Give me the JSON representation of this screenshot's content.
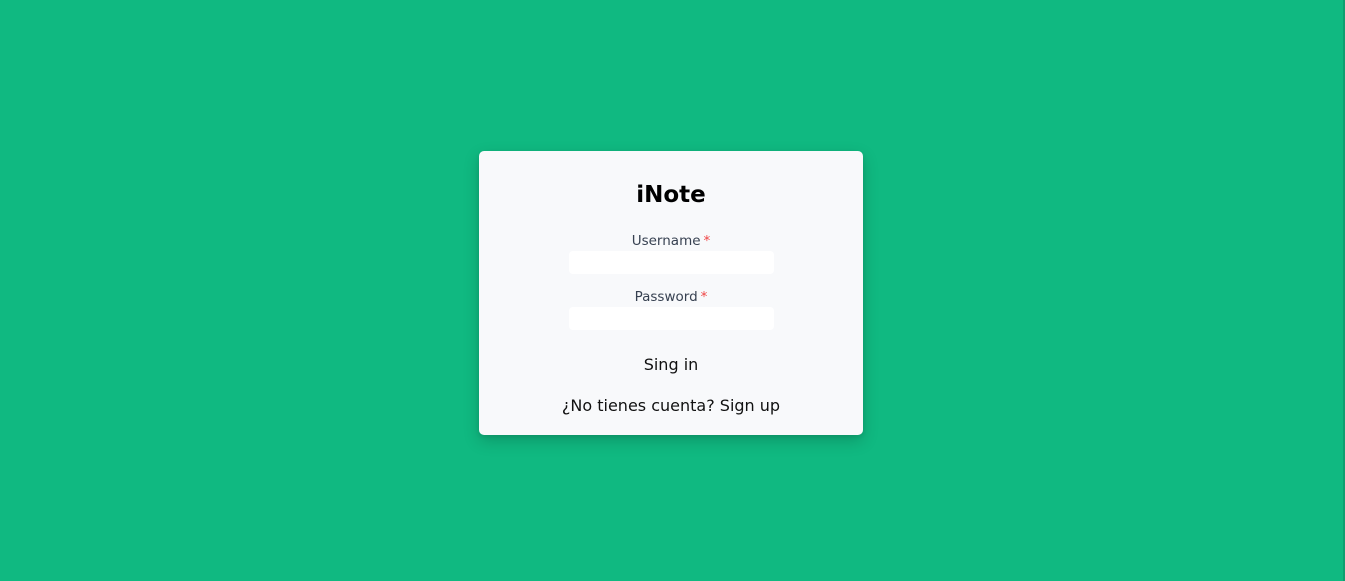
{
  "app": {
    "title": "iNote"
  },
  "form": {
    "username": {
      "label": "Username",
      "required_mark": "*",
      "value": "",
      "placeholder": ""
    },
    "password": {
      "label": "Password",
      "required_mark": "*",
      "value": "",
      "placeholder": ""
    },
    "submit_label": "Sing in",
    "signup_prompt": "¿No tienes cuenta?",
    "signup_link": "Sign up"
  },
  "colors": {
    "background": "#10b981",
    "card": "#f8f9fb",
    "required": "#ef4444"
  }
}
